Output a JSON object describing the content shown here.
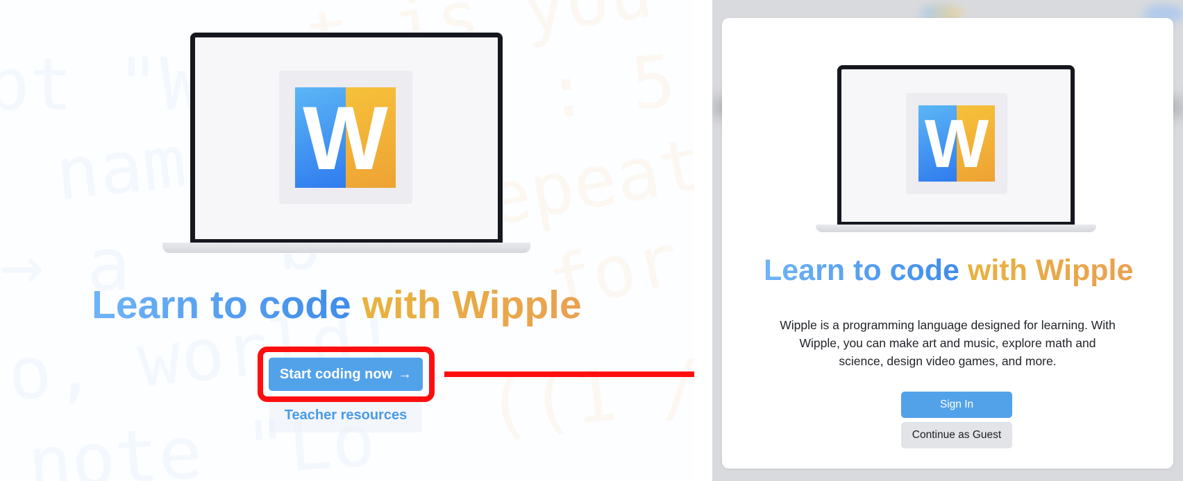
{
  "landing": {
    "background_code": [
      "pt \"W",
      "t is you",
      "n : 5",
      "nam",
      "epeat",
      "→ a",
      "b",
      "for",
      "o, world!",
      "((1 /",
      "note \"Lo"
    ],
    "logo": {
      "letter": "W",
      "left_color": "#3d8df0",
      "right_color": "#f2b238",
      "icon": "wipple-logo-icon"
    },
    "headline": {
      "part1": "Learn to code",
      "part2": "with Wipple"
    },
    "start_button": {
      "label": "Start coding now",
      "icon": "→"
    },
    "teacher_link": {
      "label": "Teacher resources"
    },
    "highlight_color": "#ff0e10"
  },
  "modal": {
    "logo": {
      "letter": "W",
      "icon": "wipple-logo-icon"
    },
    "headline": {
      "part1": "Learn to code",
      "part2": "with Wipple"
    },
    "description": "Wipple is a programming language designed for learning. With Wipple, you can make art and music, explore math and science, design video games, and more.",
    "sign_in_button": {
      "label": "Sign In"
    },
    "guest_button": {
      "label": "Continue as Guest"
    }
  },
  "colors": {
    "brand_blue": "#52a2ea",
    "brand_orange": "#eaa74a",
    "arrow_red": "#ff0e10"
  }
}
